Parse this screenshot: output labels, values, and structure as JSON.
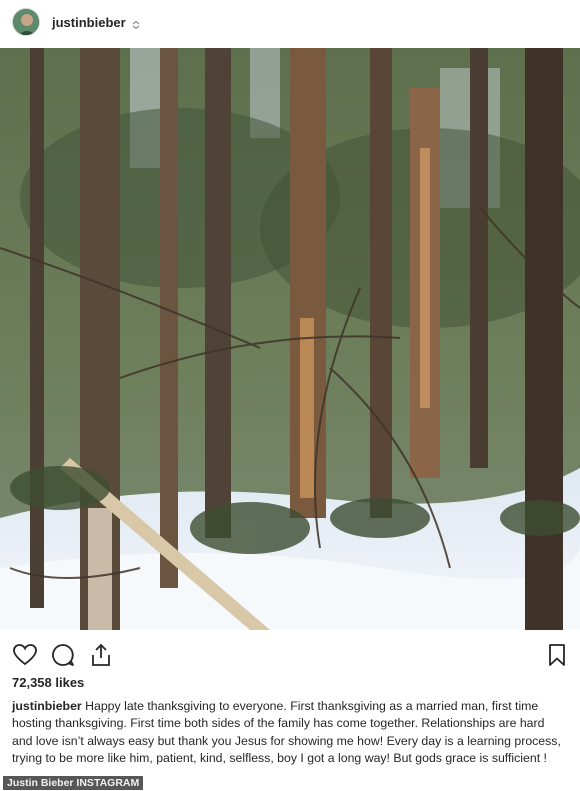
{
  "post": {
    "username": "justinbieber",
    "likes": "72,358 likes",
    "caption_user": "justinbieber",
    "caption_text": "Happy late thanksgiving to everyone. First thanksgiving as a married man, first time hosting thanksgiving. First time both sides of the family has come together. Relationships are hard and love isn’t always easy but thank you Jesus for showing me how! Every day is a learning process, trying to be more like him, patient, kind, selfless, boy I got a long way! But gods grace is sufficient !"
  },
  "credit": "Justin Bieber INSTAGRAM",
  "icons": {
    "like": "heart-icon",
    "comment": "comment-icon",
    "share": "share-icon",
    "save": "bookmark-icon",
    "verified": "verified-badge-icon"
  },
  "colors": {
    "text": "#262626",
    "snow": "#eef3f8",
    "forest": "#4a5a3a"
  }
}
